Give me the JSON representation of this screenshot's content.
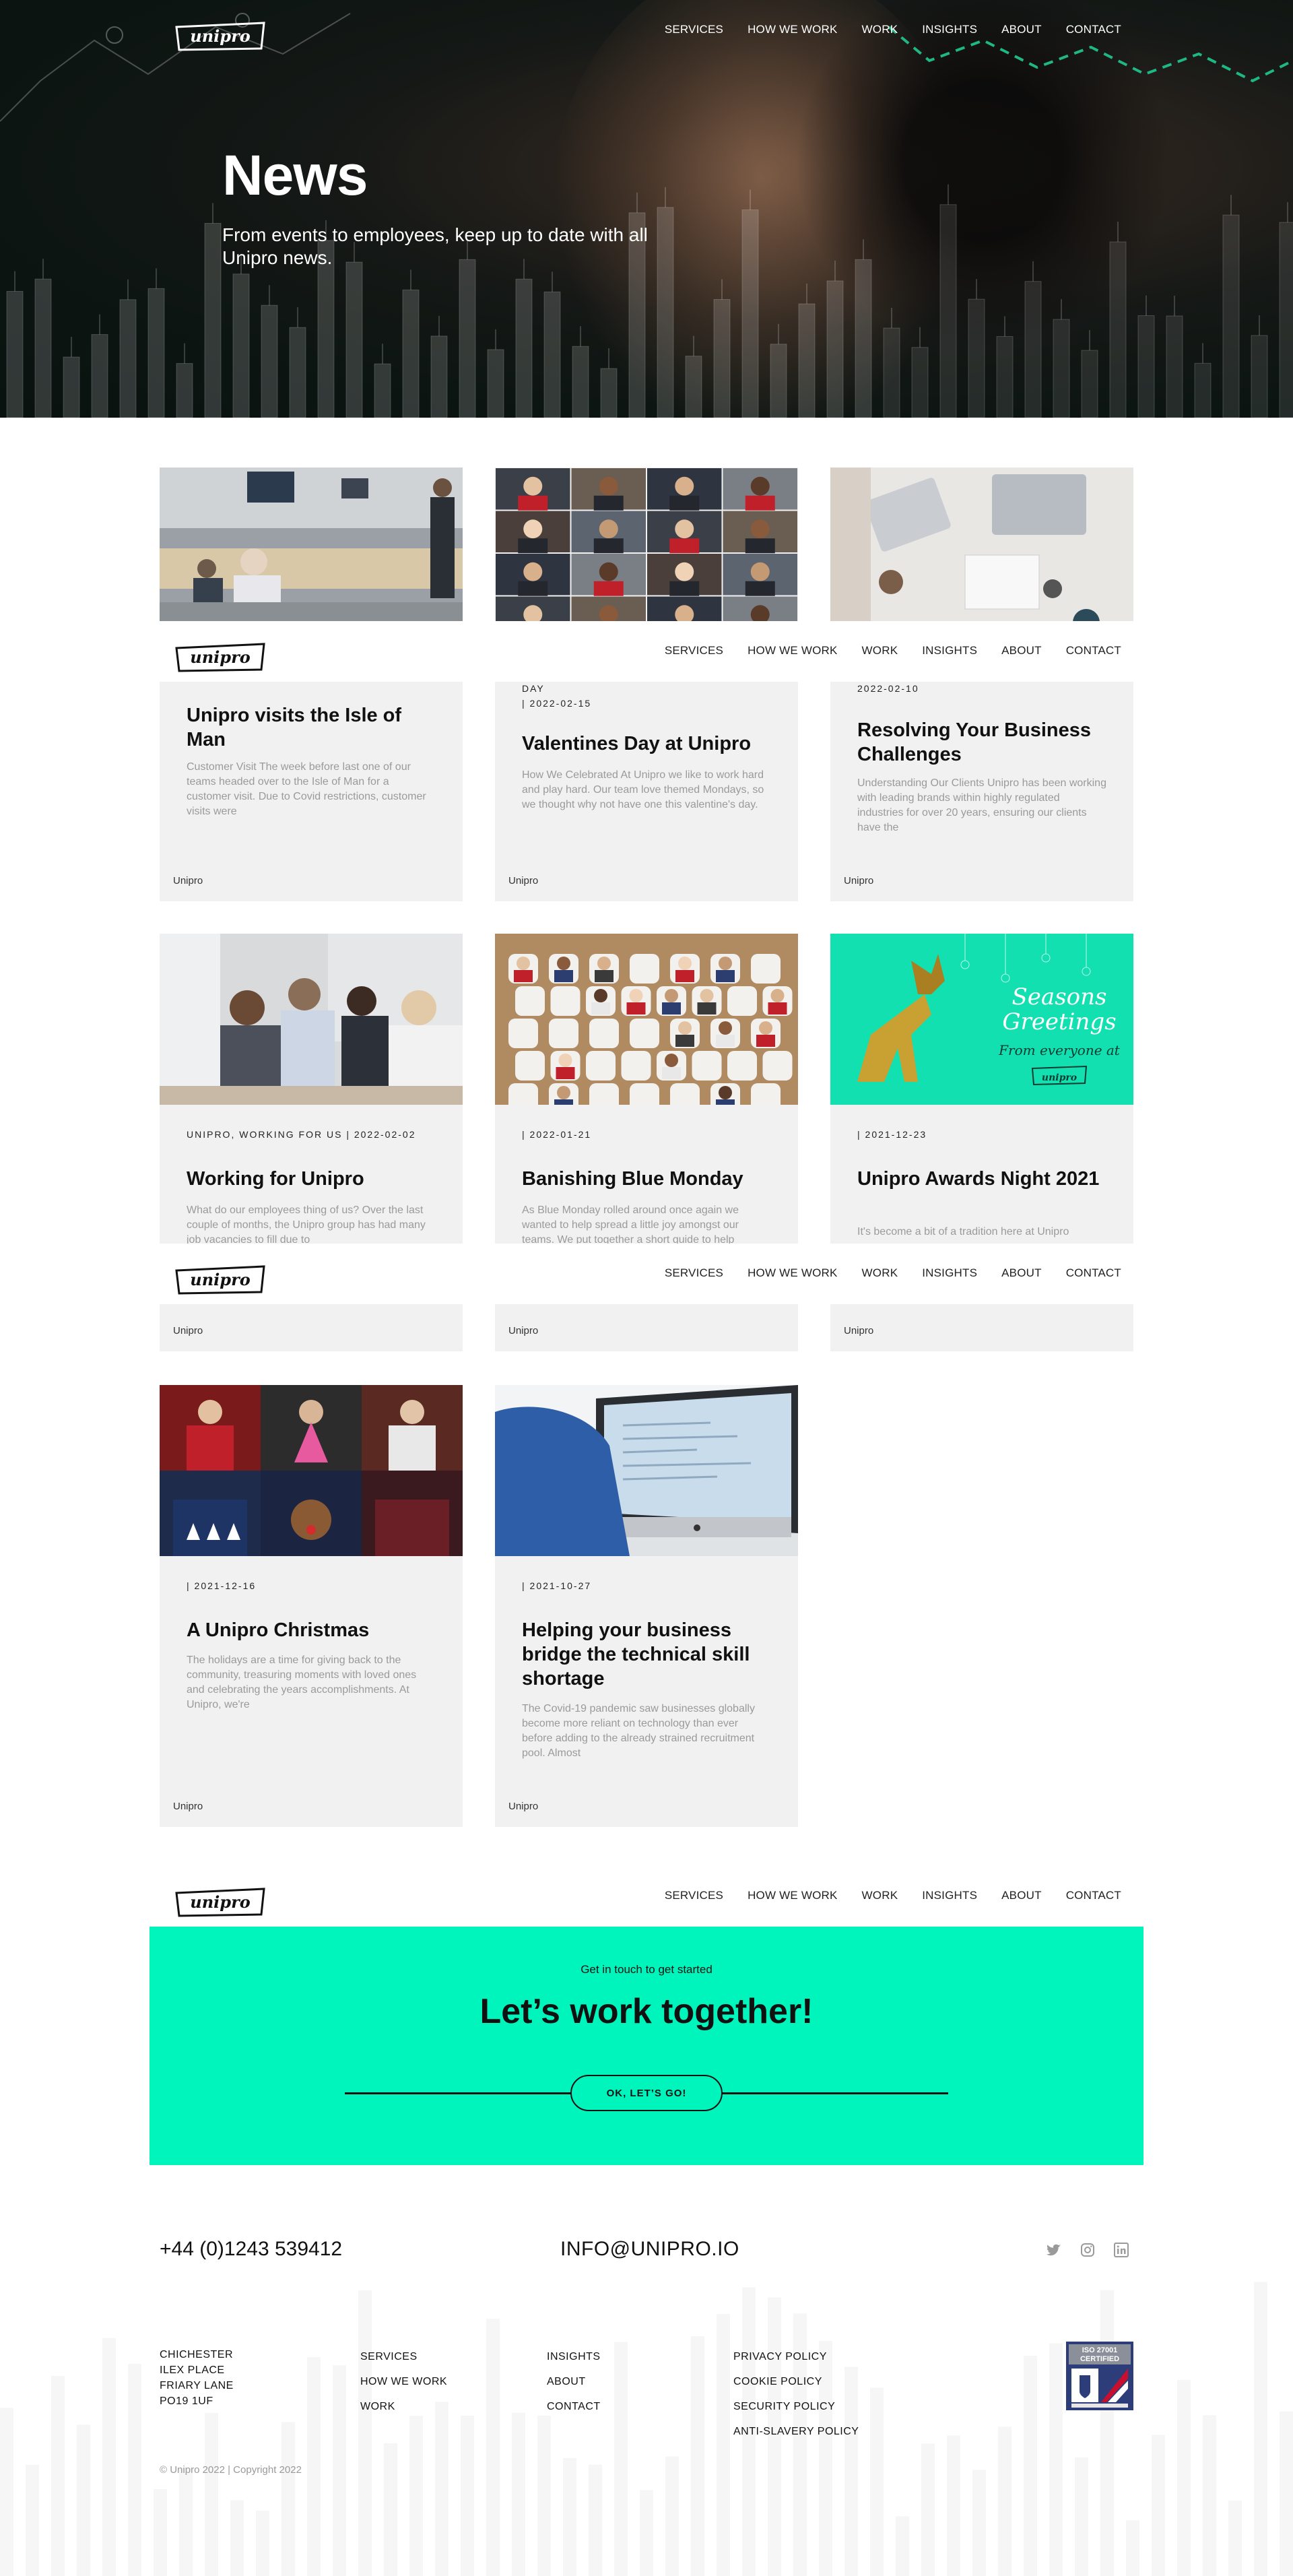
{
  "brand": {
    "logo_text": "unipro"
  },
  "nav": {
    "items": [
      "SERVICES",
      "HOW WE WORK",
      "WORK",
      "INSIGHTS",
      "ABOUT",
      "CONTACT"
    ]
  },
  "hero": {
    "title": "News",
    "subtitle": "From events to employees, keep up to date with all Unipro news."
  },
  "posts": [
    {
      "meta": "",
      "title": "Unipro visits the Isle of Man",
      "excerpt": "Customer Visit The week before last one of our teams headed over to the Isle of Man for a customer visit. Due to Covid restrictions, customer visits were",
      "author": "Unipro",
      "image": "office-meeting-photo"
    },
    {
      "meta_top": "DAY",
      "meta": "| 2022-02-15",
      "title": "Valentines Day at Unipro",
      "excerpt": "  How We Celebrated At Unipro we like to work hard and play hard. Our team love themed Mondays, so we thought why not have one this valentine's day.",
      "author": "Unipro",
      "image": "video-call-grid-photo"
    },
    {
      "meta": "2022-02-10",
      "title": "Resolving Your Business Challenges",
      "excerpt": "Understanding Our Clients  Unipro has been working with leading brands within highly regulated industries for over 20 years, ensuring our clients have the",
      "author": "Unipro",
      "image": "desk-laptops-photo"
    },
    {
      "meta": "UNIPRO, WORKING FOR US | 2022-02-02",
      "title": "Working for Unipro",
      "excerpt": "What do our employees thing of us? Over the last couple of months, the Unipro group has had many job vacancies to fill due to",
      "author": "Unipro",
      "image": "team-discussion-photo"
    },
    {
      "meta": "| 2022-01-21",
      "title": "Banishing Blue Monday",
      "excerpt": "As Blue Monday rolled around once again we wanted to help spread a little joy amongst our teams. We put together a short guide to help",
      "author": "Unipro",
      "image": "virtual-audience-photo"
    },
    {
      "meta": "| 2021-12-23",
      "title": "Unipro Awards Night 2021",
      "excerpt": "It's become a bit of a tradition here at Unipro",
      "author": "Unipro",
      "image": "seasons-greetings-card",
      "greeting_line1": "Seasons",
      "greeting_line2": "Greetings",
      "greeting_line3": "From everyone at"
    },
    {
      "meta": "| 2021-12-16",
      "title": "A Unipro Christmas",
      "excerpt": "The holidays are a time for giving back to the community, treasuring moments with loved ones and celebrating the years accomplishments. At Unipro, we're",
      "author": "Unipro",
      "image": "christmas-jumpers-photo"
    },
    {
      "meta": "| 2021-10-27",
      "title": "Helping your business bridge the technical skill shortage",
      "excerpt": "The Covid-19 pandemic saw businesses globally become more reliant on technology than ever before adding to the already strained recruitment pool. Almost",
      "author": "Unipro",
      "image": "computer-screen-photo"
    }
  ],
  "cta": {
    "kicker": "Get in touch to get started",
    "headline": "Let’s work together!",
    "button": "OK, LET’S GO!"
  },
  "footer": {
    "phone": "+44 (0)1243 539412",
    "email": "INFO@UNIPRO.IO",
    "social": [
      "twitter-icon",
      "instagram-icon",
      "linkedin-icon"
    ],
    "address": [
      "CHICHESTER",
      "ILEX PLACE",
      "FRIARY LANE",
      "PO19 1UF"
    ],
    "col1": [
      "SERVICES",
      "HOW WE WORK",
      "WORK"
    ],
    "col2": [
      "INSIGHTS",
      "ABOUT",
      "CONTACT"
    ],
    "col3": [
      "PRIVACY POLICY",
      "COOKIE POLICY",
      "SECURITY POLICY",
      "ANTI-SLAVERY POLICY"
    ],
    "iso": {
      "line1": "ISO 27001",
      "line2": "CERTIFIED"
    },
    "copyright": "© Unipro 2022 | Copyright 2022"
  },
  "colors": {
    "accent": "#00f5bd",
    "card_bg": "#f1f1f1",
    "excerpt": "#9a9a9a",
    "hero_chart": "#3ddc9f"
  }
}
